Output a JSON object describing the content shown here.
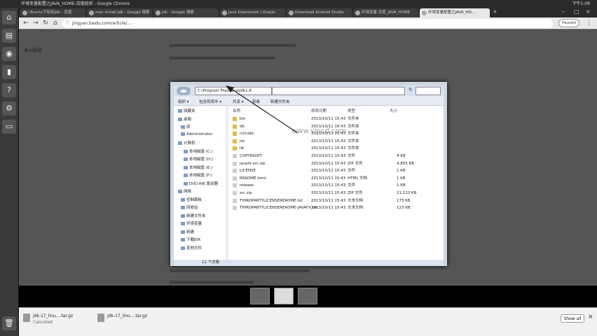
{
  "top_bar": {
    "title": "环境变量配置之JAVA_HOME-百度经验 - Google Chrome",
    "clock": "下午1:09"
  },
  "launcher": {
    "items": [
      "home-icon",
      "files-icon",
      "terminal-icon",
      "help-icon",
      "settings-icon",
      "trash-icon"
    ]
  },
  "tabs": [
    {
      "label": "Ubuntu下如何jdk - 百度"
    },
    {
      "label": "mac install jdk - Google 搜索"
    },
    {
      "label": "jdk - Google 搜索"
    },
    {
      "label": "Java Downloads | Oracle"
    },
    {
      "label": "Download Android Studio"
    },
    {
      "label": "环境变量 百度_JAVA_HOME"
    },
    {
      "label": "环境变量配置之JAVA_HO..."
    }
  ],
  "omnibox": {
    "url": "jingyan.baidu.com/article/...",
    "paused_label": "Paused"
  },
  "page": {
    "logo": "Bai经验"
  },
  "explorer": {
    "path": "C:\\Program Files\\Java\\jdk1.8",
    "toolbar": [
      "组织 ▾",
      "包含到库中 ▾",
      "共享 ▾",
      "刻录",
      "新建文件夹"
    ],
    "nav_items": [
      "收藏夹",
      "桌面",
      "库",
      "Administrator",
      "计算机",
      "本地磁盘 (C:)",
      "本地磁盘 (D:)",
      "本地磁盘 (E:)",
      "本地磁盘 (F:)",
      "DVD RW 驱动器",
      "网络",
      "控制面板",
      "回收站",
      "新建文件夹",
      "环境变量",
      "新建",
      "下载JDK",
      "其他文件"
    ],
    "headers": [
      "名称",
      "修改日期",
      "类型",
      "大小"
    ],
    "files": [
      {
        "name": "bin",
        "date": "2013/10/11 15:43",
        "type": "文件夹",
        "size": "",
        "kind": "folder"
      },
      {
        "name": "db",
        "date": "2013/10/11 15:43",
        "type": "文件夹",
        "size": "",
        "kind": "folder"
      },
      {
        "name": "include",
        "date": "2013/10/11 15:43",
        "type": "文件夹",
        "size": "",
        "kind": "folder"
      },
      {
        "name": "jre",
        "date": "2013/10/11 15:43",
        "type": "文件夹",
        "size": "",
        "kind": "folder"
      },
      {
        "name": "lib",
        "date": "2013/10/11 15:43",
        "type": "文件夹",
        "size": "",
        "kind": "folder"
      },
      {
        "name": "COPYRIGHT",
        "date": "2013/10/11 15:43",
        "type": "文件",
        "size": "4 KB",
        "kind": "file"
      },
      {
        "name": "javafx-src.zip",
        "date": "2013/10/11 15:43",
        "type": "ZIP 文件",
        "size": "4,855 KB",
        "kind": "file"
      },
      {
        "name": "LICENSE",
        "date": "2013/10/11 15:43",
        "type": "文件",
        "size": "1 KB",
        "kind": "file"
      },
      {
        "name": "README.html",
        "date": "2013/10/11 15:43",
        "type": "HTML 文档",
        "size": "1 KB",
        "kind": "file"
      },
      {
        "name": "release",
        "date": "2013/10/11 15:43",
        "type": "文件",
        "size": "1 KB",
        "kind": "file"
      },
      {
        "name": "src.zip",
        "date": "2013/10/11 15:43",
        "type": "ZIP 文件",
        "size": "21,123 KB",
        "kind": "file"
      },
      {
        "name": "THIRDPARTYLICENSEREADME.txt",
        "date": "2013/10/11 15:43",
        "type": "文本文档",
        "size": "173 KB",
        "kind": "file"
      },
      {
        "name": "THIRDPARTYLICENSEREADME-JAVAFX.txt",
        "date": "2013/10/11 15:43",
        "type": "文本文档",
        "size": "123 KB",
        "kind": "file"
      }
    ],
    "watermark": "www.vipcd.com",
    "status": "11 个对象"
  },
  "downloads": [
    {
      "name": "jdk-17_linu....tar.gz",
      "status": "Canceled"
    },
    {
      "name": "jdk-17_linu....tar.gz",
      "status": ""
    }
  ],
  "download_bar": {
    "show_all": "Show all"
  }
}
